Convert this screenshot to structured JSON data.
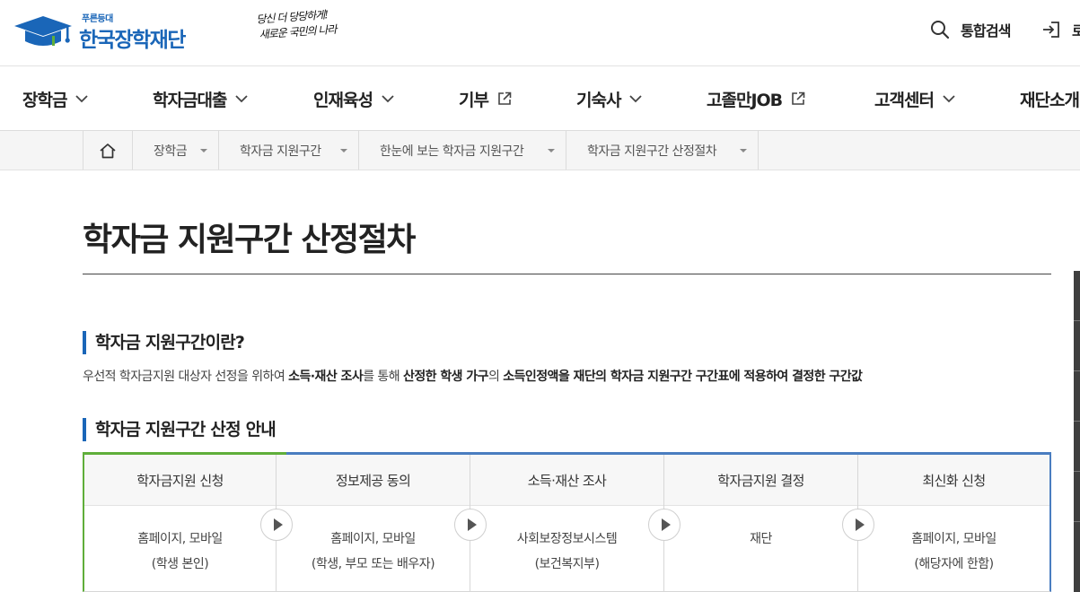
{
  "header": {
    "logo_sub": "푸른등대",
    "logo_name": "한국장학재단",
    "slogan_line1": "당신 더 당당하게!",
    "slogan_line2": "새로운 국민의 나라",
    "search_label": "통합검색",
    "login_label": "로"
  },
  "gnb": {
    "items": [
      {
        "label": "장학금",
        "icon": "chevron-down-icon"
      },
      {
        "label": "학자금대출",
        "icon": "chevron-down-icon"
      },
      {
        "label": "인재육성",
        "icon": "chevron-down-icon"
      },
      {
        "label": "기부",
        "icon": "external-link-icon"
      },
      {
        "label": "기숙사",
        "icon": "chevron-down-icon"
      },
      {
        "label": "고졸만JOB",
        "icon": "external-link-icon"
      },
      {
        "label": "고객센터",
        "icon": "chevron-down-icon"
      },
      {
        "label": "재단소개",
        "icon": "chevron-down-icon"
      }
    ]
  },
  "breadcrumb": {
    "home_icon": "home-icon",
    "items": [
      "장학금",
      "학자금 지원구간",
      "한눈에 보는 학자금 지원구간",
      "학자금 지원구간 산정절차"
    ]
  },
  "page": {
    "title": "학자금 지원구간 산정절차"
  },
  "section1": {
    "heading": "학자금 지원구간이란?",
    "desc_parts": [
      "우선적 학자금지원 대상자 선정을 위하여 ",
      "소득·재산 조사",
      "를 통해 ",
      "산정한 학생 가구",
      "의 ",
      "소득인정액을 재단의 학자금 지원구간 구간표에 적용하여 결정한 구간값"
    ]
  },
  "section2": {
    "heading": "학자금 지원구간 산정 안내",
    "steps": [
      {
        "title": "학자금지원 신청",
        "line1": "홈페이지, 모바일",
        "line2": "(학생 본인)"
      },
      {
        "title": "정보제공 동의",
        "line1": "홈페이지, 모바일",
        "line2": "(학생, 부모 또는 배우자)"
      },
      {
        "title": "소득·재산 조사",
        "line1": "사회보장정보시스템",
        "line2": "(보건복지부)"
      },
      {
        "title": "학자금지원 결정",
        "line1": "재단",
        "line2": ""
      },
      {
        "title": "최신화 신청",
        "line1": "홈페이지, 모바일",
        "line2": "(해당자에 한함)"
      }
    ]
  },
  "colors": {
    "brand": "#1a66b8",
    "accent_green": "#5fae3a",
    "accent_blue": "#4a7dc0"
  }
}
